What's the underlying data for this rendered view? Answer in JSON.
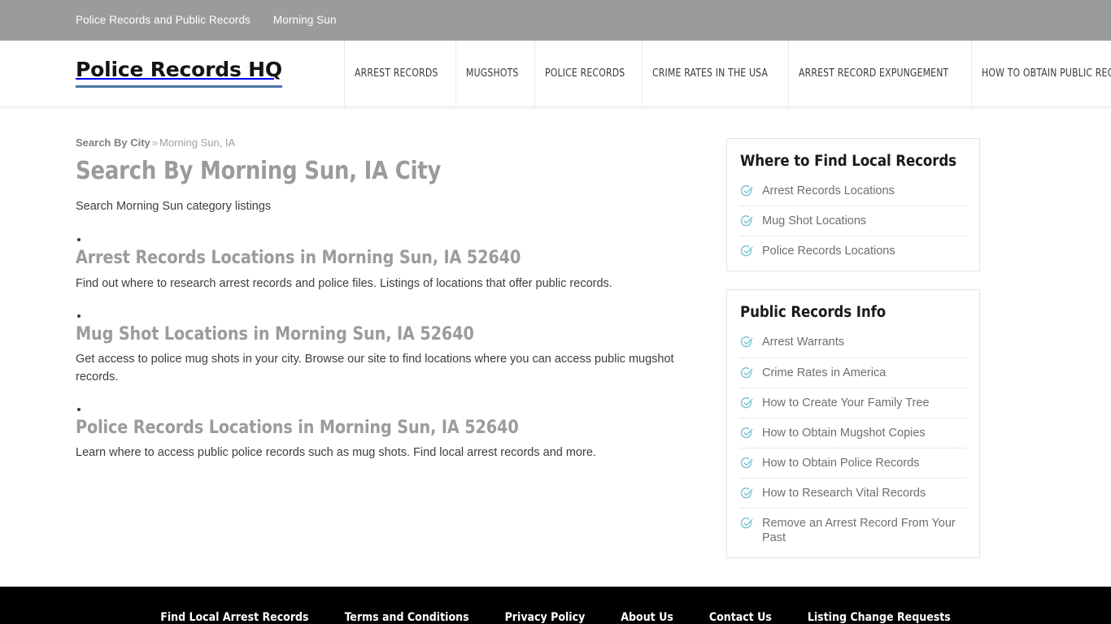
{
  "topbar": {
    "links": [
      {
        "label": "Police Records and Public Records"
      },
      {
        "label": "Morning Sun"
      }
    ]
  },
  "header": {
    "brand": "Police Records HQ",
    "brand_underline_color": "#4a77a8",
    "nav": [
      {
        "label": "ARREST RECORDS"
      },
      {
        "label": "MUGSHOTS"
      },
      {
        "label": "POLICE RECORDS"
      },
      {
        "label": "CRIME RATES IN THE USA"
      },
      {
        "label": "ARREST RECORD EXPUNGEMENT"
      },
      {
        "label": "HOW TO OBTAIN PUBLIC RECORDS"
      }
    ]
  },
  "breadcrumb": {
    "parent": "Search By City",
    "separator": "»",
    "current": "Morning Sun, IA"
  },
  "main": {
    "title": "Search By Morning Sun, IA City",
    "subtitle": "Search Morning Sun category listings",
    "listings": [
      {
        "title": "Arrest Records Locations in Morning Sun, IA 52640",
        "description": "Find out where to research arrest records and police files. Listings of locations that offer public records."
      },
      {
        "title": "Mug Shot Locations in Morning Sun, IA 52640",
        "description": "Get access to police mug shots in your city. Browse our site to find locations where you can access public mugshot records."
      },
      {
        "title": "Police Records Locations in Morning Sun, IA 52640",
        "description": "Learn where to access public police records such as mug shots. Find local arrest records and more."
      }
    ]
  },
  "sidebar": {
    "check_icon_color": "#7ec3d6",
    "widgets": [
      {
        "title": "Where to Find Local Records",
        "items": [
          {
            "label": "Arrest Records Locations",
            "icon": "check-circle-icon"
          },
          {
            "label": "Mug Shot Locations",
            "icon": "check-circle-icon"
          },
          {
            "label": "Police Records Locations",
            "icon": "check-circle-icon"
          }
        ]
      },
      {
        "title": "Public Records Info",
        "items": [
          {
            "label": "Arrest Warrants",
            "icon": "check-circle-icon"
          },
          {
            "label": "Crime Rates in America",
            "icon": "check-circle-icon"
          },
          {
            "label": "How to Create Your Family Tree",
            "icon": "check-circle-icon"
          },
          {
            "label": "How to Obtain Mugshot Copies",
            "icon": "check-circle-icon"
          },
          {
            "label": "How to Obtain Police Records",
            "icon": "check-circle-icon"
          },
          {
            "label": "How to Research Vital Records",
            "icon": "check-circle-icon"
          },
          {
            "label": "Remove an Arrest Record From Your Past",
            "icon": "check-circle-icon"
          }
        ]
      }
    ]
  },
  "footer": {
    "links": [
      {
        "label": "Find Local Arrest Records"
      },
      {
        "label": "Terms and Conditions"
      },
      {
        "label": "Privacy Policy"
      },
      {
        "label": "About Us"
      },
      {
        "label": "Contact Us"
      },
      {
        "label": "Listing Change Requests"
      }
    ]
  }
}
